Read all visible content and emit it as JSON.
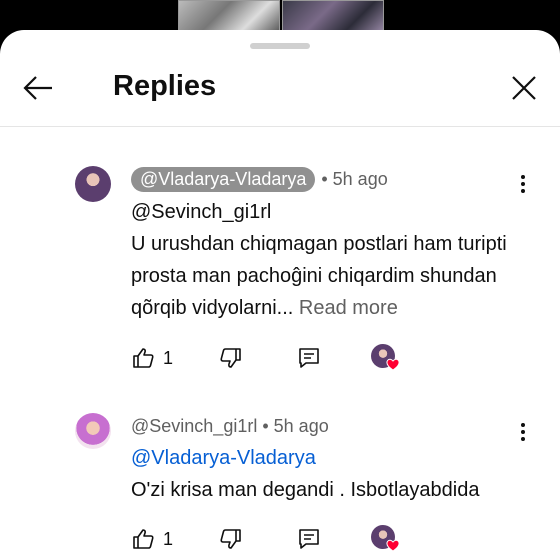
{
  "header": {
    "title": "Replies"
  },
  "comments": [
    {
      "author": "@Vladarya-Vladarya",
      "time": "• 5h ago",
      "mention": "@Sevinch_gi1rl",
      "body": "U urushdan chiqmagan postlari ham turipti prosta man pachoĝini chiqardim shundan qõrqib vidyolarni... ",
      "read_more": "Read more",
      "likes": "1"
    },
    {
      "author": "@Sevinch_gi1rl",
      "time": "• 5h ago",
      "mention": " @Vladarya-Vladarya",
      "body": "O'zi krisa man degandi . Isbotlayabdida",
      "likes": "1"
    }
  ],
  "icons": {
    "back": "arrow-left-icon",
    "close": "close-icon",
    "like": "thumbs-up-icon",
    "dislike": "thumbs-down-icon",
    "reply": "comment-icon",
    "more": "more-vert-icon",
    "creator_heart": "heart-icon"
  },
  "colors": {
    "heart": "#ff0033",
    "mention": "#065fd4",
    "chip": "#909090"
  }
}
